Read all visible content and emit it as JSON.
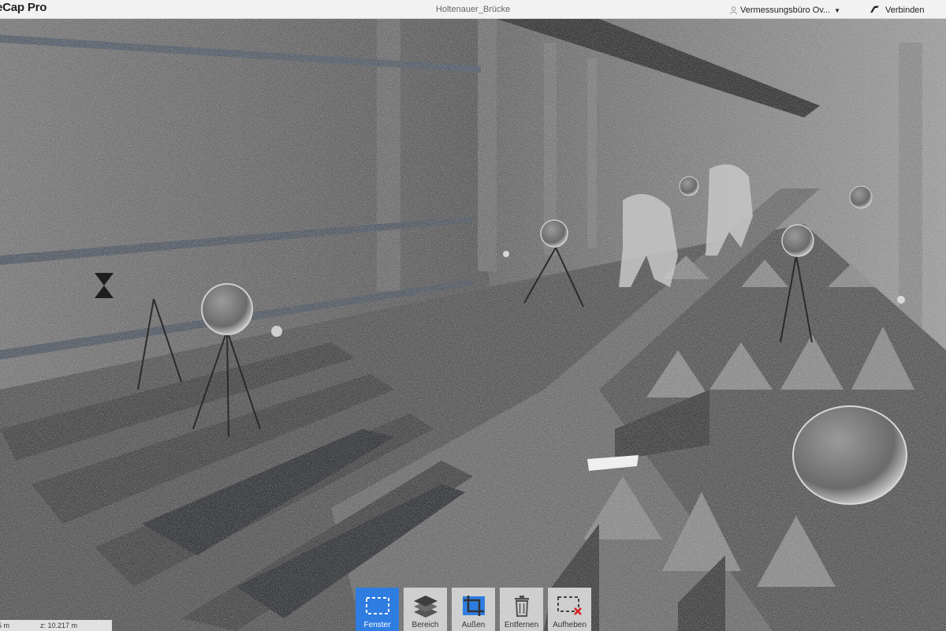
{
  "header": {
    "app_title": "eCap Pro",
    "project_name": "Holtenauer_Brücke",
    "account_label": "Vermessungsbüro Ov...",
    "connect_label": "Verbinden"
  },
  "status": {
    "left_value": "5 m",
    "z_value": "z:  10.217 m"
  },
  "toolbar": {
    "items": [
      {
        "label": "Fenster",
        "icon": "dashed-rectangle-icon",
        "active": true
      },
      {
        "label": "Bereich",
        "icon": "layers-icon",
        "active": false
      },
      {
        "label": "Außen",
        "icon": "crop-icon",
        "active": false
      },
      {
        "label": "Entfernen",
        "icon": "trash-icon",
        "active": false
      },
      {
        "label": "Aufheben",
        "icon": "clear-selection-icon",
        "active": false
      }
    ]
  },
  "colors": {
    "accent": "#2f7de1",
    "topbar": "#f2f2f2",
    "toolbar_button": "#cfcfcf"
  }
}
